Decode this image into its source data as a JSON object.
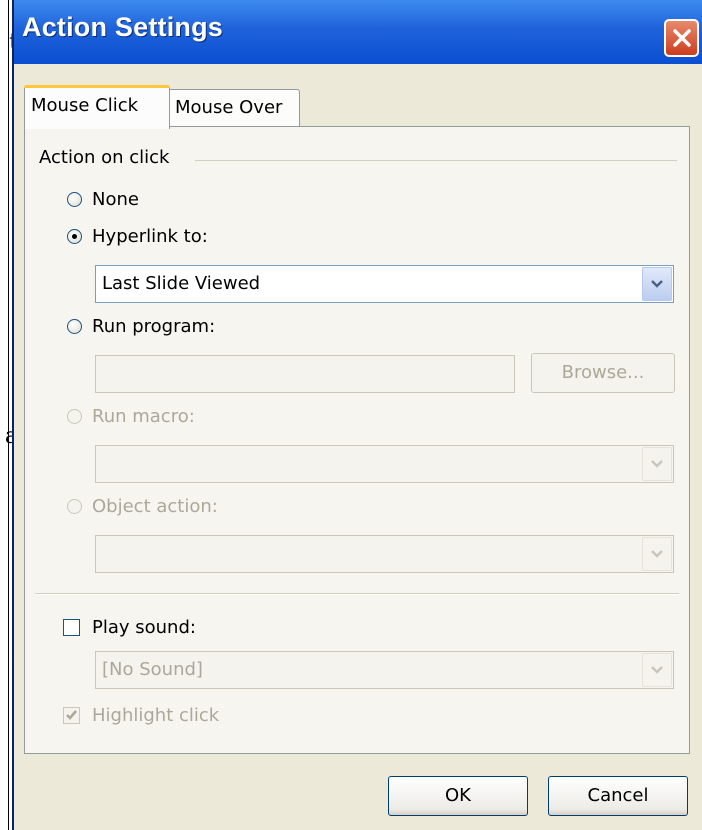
{
  "background": {
    "fragments": [
      "t",
      "a",
      ","
    ]
  },
  "dialog": {
    "title": "Action Settings",
    "tabs": [
      {
        "label": "Mouse Click",
        "active": true
      },
      {
        "label": "Mouse Over",
        "active": false
      }
    ],
    "group_label": "Action on click",
    "options": {
      "none": {
        "label": "None",
        "checked": false
      },
      "hyperlink": {
        "label": "Hyperlink to:",
        "checked": true,
        "value": "Last Slide Viewed"
      },
      "run_program": {
        "label": "Run program:",
        "checked": false,
        "value": "",
        "browse_label": "Browse..."
      },
      "run_macro": {
        "label": "Run macro:",
        "checked": false,
        "enabled": false,
        "value": ""
      },
      "object_action": {
        "label": "Object action:",
        "checked": false,
        "enabled": false,
        "value": ""
      }
    },
    "play_sound": {
      "label": "Play sound:",
      "checked": false,
      "value": "[No Sound]"
    },
    "highlight_click": {
      "label": "Highlight click",
      "checked": true,
      "enabled": false
    },
    "ok_label": "OK",
    "cancel_label": "Cancel",
    "colors": {
      "titlebar": "#0b4fd1",
      "close": "#cc3d1d",
      "face": "#ece9d8",
      "tab_highlight": "#ffc83c"
    }
  }
}
